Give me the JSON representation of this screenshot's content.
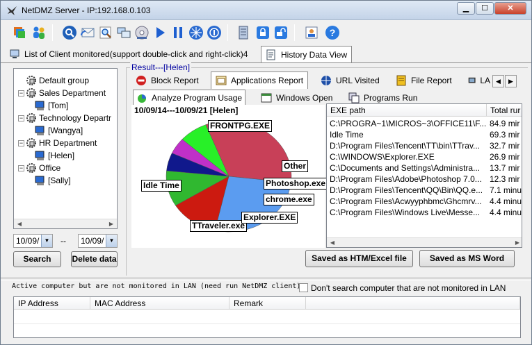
{
  "window": {
    "title": "NetDMZ Server -  IP:192.168.0.103",
    "controls": {
      "minimize": "▁",
      "maximize": "☐",
      "close": "✕"
    }
  },
  "toolbar": {
    "icons": [
      "stack-icon",
      "users-icon",
      "search-icon",
      "mail-icon",
      "magnifier-icon",
      "screens-icon",
      "disk-icon",
      "play-icon",
      "pause-icon",
      "network-icon",
      "info-icon",
      "server-icon",
      "lock-icon",
      "unlock-icon",
      "user-card-icon",
      "help-icon"
    ]
  },
  "top_tabs": {
    "client_list": "List of Client monitored(support double-click and right-click)4",
    "history": "History Data View"
  },
  "tree": {
    "items": [
      {
        "label": "Default group",
        "level": 0
      },
      {
        "label": "Sales Department",
        "level": 0
      },
      {
        "label": "[Tom]",
        "level": 1
      },
      {
        "label": "Technology Departr",
        "level": 0
      },
      {
        "label": "[Wangya]",
        "level": 1
      },
      {
        "label": "HR Department",
        "level": 0
      },
      {
        "label": "[Helen]",
        "level": 1
      },
      {
        "label": "Office",
        "level": 0
      },
      {
        "label": "[Sally]",
        "level": 1
      }
    ]
  },
  "dates": {
    "from": "10/09/",
    "dash": "--",
    "to": "10/09/"
  },
  "buttons": {
    "search": "Search",
    "delete": "Delete data",
    "save_htm": "Saved as HTM/Excel file",
    "save_word": "Saved as MS Word"
  },
  "result": {
    "label": "Result---[Helen]"
  },
  "report_tabs": [
    "Block Report",
    "Applications Report",
    "URL Visited",
    "File Report",
    "LA"
  ],
  "sub_tabs": [
    "Analyze Program Usage",
    "Windows Open",
    "Programs Run"
  ],
  "chart_data": {
    "type": "pie",
    "caption": "10/09/14---10/09/21  [Helen]",
    "slices": [
      {
        "label": "FRONTPG.EXE",
        "value": 84.9,
        "color": "#c84058"
      },
      {
        "label": "Idle Time",
        "value": 69.3,
        "color": "#5b9cf0"
      },
      {
        "label": "TTraveler.exe",
        "value": 32.7,
        "color": "#cc1a10"
      },
      {
        "label": "Explorer.EXE",
        "value": 26.9,
        "color": "#30b830"
      },
      {
        "label": "chrome.exe",
        "value": 13.7,
        "color": "#10188c"
      },
      {
        "label": "Photoshop.exe",
        "value": 12.3,
        "color": "#c030c8"
      },
      {
        "label": "Other",
        "value": 19.1,
        "color": "#28f028"
      }
    ]
  },
  "table": {
    "columns": [
      "EXE path",
      "Total rur"
    ],
    "rows": [
      [
        "C:\\PROGRA~1\\MICROS~3\\OFFICE11\\F...",
        "84.9 mir"
      ],
      [
        "Idle Time",
        "69.3 mir"
      ],
      [
        "D:\\Program Files\\Tencent\\TT\\bin\\TTrav...",
        "32.7 mir"
      ],
      [
        "C:\\WINDOWS\\Explorer.EXE",
        "26.9 mir"
      ],
      [
        "C:\\Documents and Settings\\Administra...",
        "13.7 mir"
      ],
      [
        "D:\\Program Files\\Adobe\\Photoshop 7.0...",
        "12.3 mir"
      ],
      [
        "D:\\Program Files\\Tencent\\QQ\\Bin\\QQ.e...",
        "7.1 minu"
      ],
      [
        "C:\\Program Files\\Acwyyphbmc\\Ghcmrv...",
        "4.4 minu"
      ],
      [
        "C:\\Program Files\\Windows Live\\Messe...",
        "4.4 minu"
      ]
    ]
  },
  "lower": {
    "status": "Active computer but are not monitored in LAN (need run NetDMZ client)",
    "checkbox_label": "Don't search computer that are not monitored in LAN",
    "columns": [
      "IP Address",
      "MAC Address",
      "Remark"
    ]
  }
}
